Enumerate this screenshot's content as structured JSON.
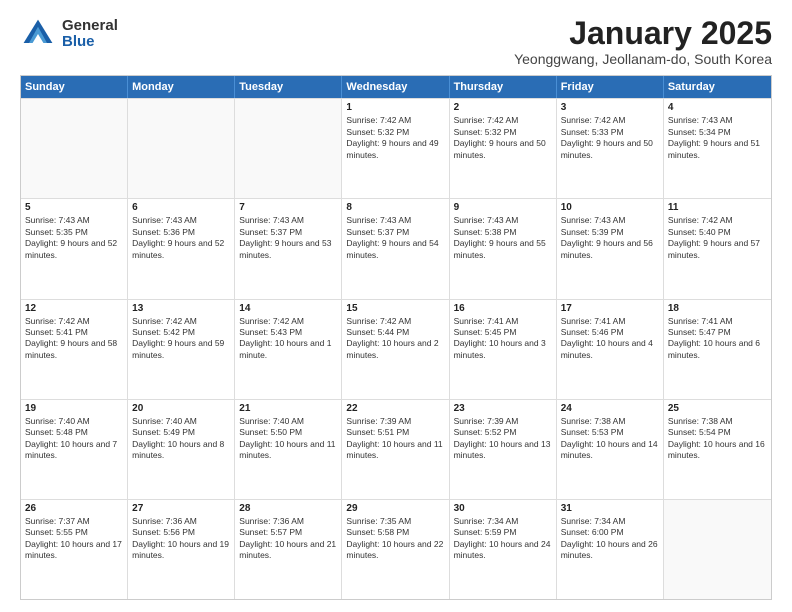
{
  "logo": {
    "general": "General",
    "blue": "Blue"
  },
  "header": {
    "month": "January 2025",
    "location": "Yeonggwang, Jeollanam-do, South Korea"
  },
  "days": [
    "Sunday",
    "Monday",
    "Tuesday",
    "Wednesday",
    "Thursday",
    "Friday",
    "Saturday"
  ],
  "weeks": [
    [
      {
        "day": "",
        "empty": true
      },
      {
        "day": "",
        "empty": true
      },
      {
        "day": "",
        "empty": true
      },
      {
        "day": "1",
        "sunrise": "7:42 AM",
        "sunset": "5:32 PM",
        "daylight": "9 hours and 49 minutes."
      },
      {
        "day": "2",
        "sunrise": "7:42 AM",
        "sunset": "5:32 PM",
        "daylight": "9 hours and 50 minutes."
      },
      {
        "day": "3",
        "sunrise": "7:42 AM",
        "sunset": "5:33 PM",
        "daylight": "9 hours and 50 minutes."
      },
      {
        "day": "4",
        "sunrise": "7:43 AM",
        "sunset": "5:34 PM",
        "daylight": "9 hours and 51 minutes."
      }
    ],
    [
      {
        "day": "5",
        "sunrise": "7:43 AM",
        "sunset": "5:35 PM",
        "daylight": "9 hours and 52 minutes."
      },
      {
        "day": "6",
        "sunrise": "7:43 AM",
        "sunset": "5:36 PM",
        "daylight": "9 hours and 52 minutes."
      },
      {
        "day": "7",
        "sunrise": "7:43 AM",
        "sunset": "5:37 PM",
        "daylight": "9 hours and 53 minutes."
      },
      {
        "day": "8",
        "sunrise": "7:43 AM",
        "sunset": "5:37 PM",
        "daylight": "9 hours and 54 minutes."
      },
      {
        "day": "9",
        "sunrise": "7:43 AM",
        "sunset": "5:38 PM",
        "daylight": "9 hours and 55 minutes."
      },
      {
        "day": "10",
        "sunrise": "7:43 AM",
        "sunset": "5:39 PM",
        "daylight": "9 hours and 56 minutes."
      },
      {
        "day": "11",
        "sunrise": "7:42 AM",
        "sunset": "5:40 PM",
        "daylight": "9 hours and 57 minutes."
      }
    ],
    [
      {
        "day": "12",
        "sunrise": "7:42 AM",
        "sunset": "5:41 PM",
        "daylight": "9 hours and 58 minutes."
      },
      {
        "day": "13",
        "sunrise": "7:42 AM",
        "sunset": "5:42 PM",
        "daylight": "9 hours and 59 minutes."
      },
      {
        "day": "14",
        "sunrise": "7:42 AM",
        "sunset": "5:43 PM",
        "daylight": "10 hours and 1 minute."
      },
      {
        "day": "15",
        "sunrise": "7:42 AM",
        "sunset": "5:44 PM",
        "daylight": "10 hours and 2 minutes."
      },
      {
        "day": "16",
        "sunrise": "7:41 AM",
        "sunset": "5:45 PM",
        "daylight": "10 hours and 3 minutes."
      },
      {
        "day": "17",
        "sunrise": "7:41 AM",
        "sunset": "5:46 PM",
        "daylight": "10 hours and 4 minutes."
      },
      {
        "day": "18",
        "sunrise": "7:41 AM",
        "sunset": "5:47 PM",
        "daylight": "10 hours and 6 minutes."
      }
    ],
    [
      {
        "day": "19",
        "sunrise": "7:40 AM",
        "sunset": "5:48 PM",
        "daylight": "10 hours and 7 minutes."
      },
      {
        "day": "20",
        "sunrise": "7:40 AM",
        "sunset": "5:49 PM",
        "daylight": "10 hours and 8 minutes."
      },
      {
        "day": "21",
        "sunrise": "7:40 AM",
        "sunset": "5:50 PM",
        "daylight": "10 hours and 11 minutes."
      },
      {
        "day": "22",
        "sunrise": "7:39 AM",
        "sunset": "5:51 PM",
        "daylight": "10 hours and 11 minutes."
      },
      {
        "day": "23",
        "sunrise": "7:39 AM",
        "sunset": "5:52 PM",
        "daylight": "10 hours and 13 minutes."
      },
      {
        "day": "24",
        "sunrise": "7:38 AM",
        "sunset": "5:53 PM",
        "daylight": "10 hours and 14 minutes."
      },
      {
        "day": "25",
        "sunrise": "7:38 AM",
        "sunset": "5:54 PM",
        "daylight": "10 hours and 16 minutes."
      }
    ],
    [
      {
        "day": "26",
        "sunrise": "7:37 AM",
        "sunset": "5:55 PM",
        "daylight": "10 hours and 17 minutes."
      },
      {
        "day": "27",
        "sunrise": "7:36 AM",
        "sunset": "5:56 PM",
        "daylight": "10 hours and 19 minutes."
      },
      {
        "day": "28",
        "sunrise": "7:36 AM",
        "sunset": "5:57 PM",
        "daylight": "10 hours and 21 minutes."
      },
      {
        "day": "29",
        "sunrise": "7:35 AM",
        "sunset": "5:58 PM",
        "daylight": "10 hours and 22 minutes."
      },
      {
        "day": "30",
        "sunrise": "7:34 AM",
        "sunset": "5:59 PM",
        "daylight": "10 hours and 24 minutes."
      },
      {
        "day": "31",
        "sunrise": "7:34 AM",
        "sunset": "6:00 PM",
        "daylight": "10 hours and 26 minutes."
      },
      {
        "day": "",
        "empty": true
      }
    ]
  ]
}
